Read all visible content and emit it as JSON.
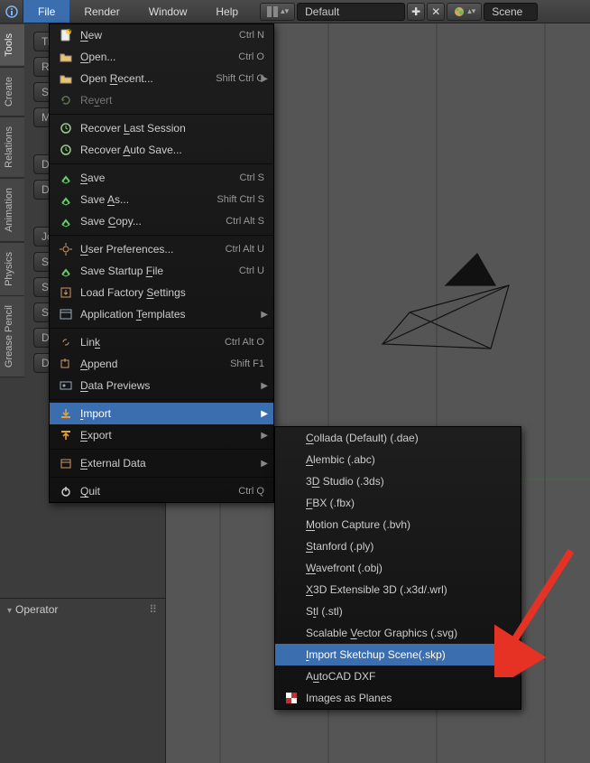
{
  "menubar": {
    "items": [
      "File",
      "Render",
      "Window",
      "Help"
    ],
    "active_index": 0,
    "layout_field": "Default",
    "scene_field": "Scene"
  },
  "vtabs": [
    "Tools",
    "Create",
    "Relations",
    "Animation",
    "Physics",
    "Grease Pencil"
  ],
  "tool_buttons": [
    "Tr",
    "Ro",
    "Sc",
    "Mi",
    "Du",
    "Du",
    "Jo",
    "Se",
    "Sh",
    "Sm",
    "Da",
    "Data"
  ],
  "operator_title": "Operator",
  "file_menu": [
    {
      "label": "New",
      "u": 0,
      "shortcut": "Ctrl N",
      "icon": "doc-new"
    },
    {
      "label": "Open...",
      "u": 0,
      "shortcut": "Ctrl O",
      "icon": "folder"
    },
    {
      "label": "Open Recent...",
      "u": 5,
      "shortcut": "Shift Ctrl O",
      "icon": "folder",
      "sub": true
    },
    {
      "label": "Revert",
      "u": 2,
      "icon": "revert",
      "dim": true
    },
    {
      "sep": true
    },
    {
      "label": "Recover Last Session",
      "u": 8,
      "icon": "recover"
    },
    {
      "label": "Recover Auto Save...",
      "u": 8,
      "icon": "recover"
    },
    {
      "sep": true
    },
    {
      "label": "Save",
      "u": 0,
      "shortcut": "Ctrl S",
      "icon": "save"
    },
    {
      "label": "Save As...",
      "u": 5,
      "shortcut": "Shift Ctrl S",
      "icon": "save"
    },
    {
      "label": "Save Copy...",
      "u": 5,
      "shortcut": "Ctrl Alt S",
      "icon": "save"
    },
    {
      "sep": true
    },
    {
      "label": "User Preferences...",
      "u": 0,
      "shortcut": "Ctrl Alt U",
      "icon": "gear"
    },
    {
      "label": "Save Startup File",
      "u": 13,
      "shortcut": "Ctrl U",
      "icon": "save"
    },
    {
      "label": "Load Factory Settings",
      "u": 13,
      "icon": "load"
    },
    {
      "label": "Application Templates",
      "u": 12,
      "icon": "template",
      "sub": true
    },
    {
      "sep": true
    },
    {
      "label": "Link",
      "u": 3,
      "shortcut": "Ctrl Alt O",
      "icon": "link"
    },
    {
      "label": "Append",
      "u": 0,
      "shortcut": "Shift F1",
      "icon": "append"
    },
    {
      "label": "Data Previews",
      "u": 0,
      "icon": "preview",
      "sub": true
    },
    {
      "sep": true
    },
    {
      "label": "Import",
      "u": 0,
      "icon": "import",
      "sub": true,
      "selected": true
    },
    {
      "label": "Export",
      "u": 0,
      "icon": "export",
      "sub": true
    },
    {
      "sep": true
    },
    {
      "label": "External Data",
      "u": 0,
      "icon": "pkg",
      "sub": true
    },
    {
      "sep": true
    },
    {
      "label": "Quit",
      "u": 0,
      "shortcut": "Ctrl Q",
      "icon": "power"
    }
  ],
  "import_submenu": [
    {
      "label": "Collada (Default) (.dae)",
      "u": 0
    },
    {
      "label": "Alembic (.abc)",
      "u": 0
    },
    {
      "label": "3D Studio (.3ds)",
      "u": 1
    },
    {
      "label": "FBX (.fbx)",
      "u": 0
    },
    {
      "label": "Motion Capture (.bvh)",
      "u": 0
    },
    {
      "label": "Stanford (.ply)",
      "u": 0
    },
    {
      "label": "Wavefront (.obj)",
      "u": 0
    },
    {
      "label": "X3D Extensible 3D (.x3d/.wrl)",
      "u": 0
    },
    {
      "label": "Stl (.stl)",
      "u": 1
    },
    {
      "label": "Scalable Vector Graphics (.svg)",
      "u": 9
    },
    {
      "label": "Import Sketchup Scene(.skp)",
      "u": 0,
      "selected": true
    },
    {
      "label": "AutoCAD DXF",
      "u": 1
    },
    {
      "label": "Images as Planes",
      "icon": "checker"
    }
  ]
}
